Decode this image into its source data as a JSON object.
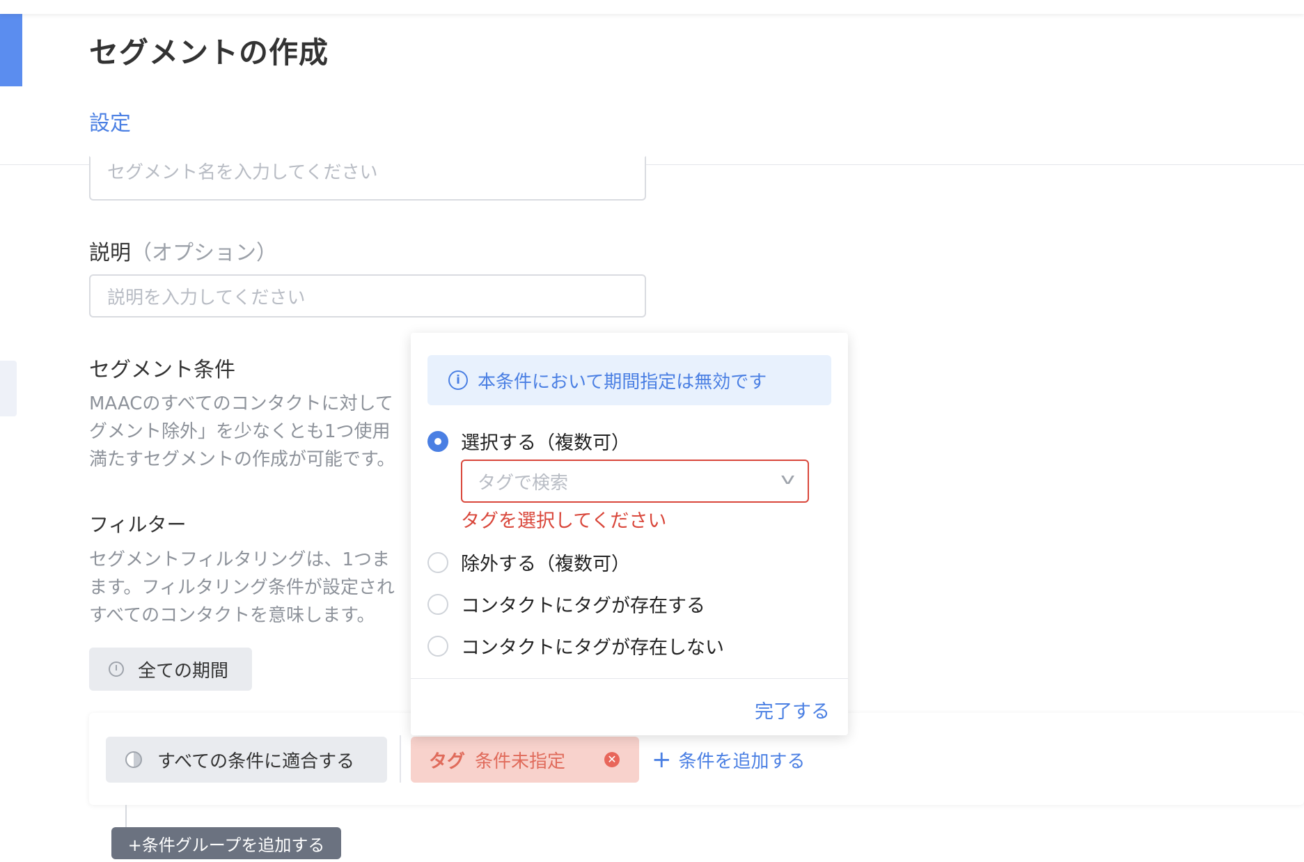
{
  "page": {
    "title": "セグメントの作成",
    "tab_settings": "設定"
  },
  "form": {
    "name_placeholder": "セグメント名を入力してください",
    "desc_label": "説明",
    "desc_optional": "（オプション）",
    "desc_placeholder": "説明を入力してください",
    "conditions_title": "セグメント条件",
    "conditions_desc": [
      "MAACのすべてのコンタクトに対して",
      "グメント除外」を少なくとも1つ使用",
      "満たすセグメントの作成が可能です。"
    ],
    "filter_title": "フィルター",
    "filter_desc": [
      "セグメントフィルタリングは、1つま",
      "ます。フィルタリング条件が設定され",
      "すべてのコンタクトを意味します。"
    ],
    "period_button": "全ての期間"
  },
  "condition_bar": {
    "match_all": "すべての条件に適合する",
    "tag_label": "タグ",
    "tag_status": "条件未指定",
    "add_condition": "条件を追加する",
    "add_group": "+条件グループを追加する"
  },
  "popover": {
    "notice": "本条件において期間指定は無効です",
    "options": [
      {
        "label": "選択する（複数可）",
        "selected": true
      },
      {
        "label": "除外する（複数可）",
        "selected": false
      },
      {
        "label": "コンタクトにタグが存在する",
        "selected": false
      },
      {
        "label": "コンタクトにタグが存在しない",
        "selected": false
      }
    ],
    "tag_search_placeholder": "タグで検索",
    "error": "タグを選択してください",
    "done": "完了する"
  },
  "colors": {
    "accent": "#4a7fe3",
    "error": "#d9463a",
    "chip_bg": "#f8d2cc"
  }
}
